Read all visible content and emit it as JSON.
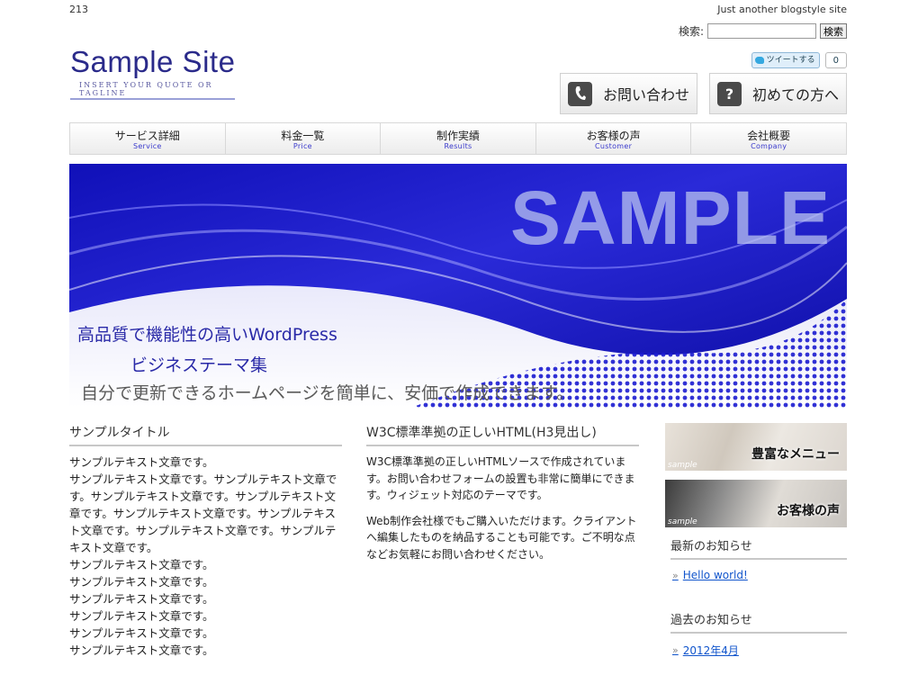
{
  "topbar": {
    "left": "213",
    "right": "Just another blogstyle site"
  },
  "search": {
    "label": "検索:",
    "button": "検索",
    "value": ""
  },
  "logo": {
    "name": "Sample Site",
    "tagline": "INSERT YOUR QUOTE OR TAGLINE"
  },
  "tweet": {
    "label": "ツイートする",
    "count": "0"
  },
  "cta": {
    "contact": "お問い合わせ",
    "first": "初めての方へ",
    "contact_icon": "phone-icon",
    "first_icon": "question-icon"
  },
  "nav": [
    {
      "jp": "サービス詳細",
      "en": "Service"
    },
    {
      "jp": "料金一覧",
      "en": "Price"
    },
    {
      "jp": "制作実績",
      "en": "Results"
    },
    {
      "jp": "お客様の声",
      "en": "Customer"
    },
    {
      "jp": "会社概要",
      "en": "Company"
    }
  ],
  "hero": {
    "big": "SAMPLE",
    "line1": "高品質で機能性の高いWordPress",
    "line2": "ビジネステーマ集",
    "line3": "自分で更新できるホームページを簡単に、安価で作成できます。"
  },
  "col1": {
    "title": "サンプルタイトル",
    "lines": [
      "サンプルテキスト文章です。",
      "サンプルテキスト文章です。サンプルテキスト文章です。サンプルテキスト文章です。サンプルテキスト文章です。サンプルテキスト文章です。サンプルテキスト文章です。サンプルテキスト文章です。サンプルテキスト文章です。",
      "サンプルテキスト文章です。",
      "サンプルテキスト文章です。",
      "サンプルテキスト文章です。",
      "サンプルテキスト文章です。",
      "サンプルテキスト文章です。",
      "サンプルテキスト文章です。"
    ]
  },
  "col2": {
    "title": "W3C標準準拠の正しいHTML(H3見出し)",
    "p1": "W3C標準準拠の正しいHTMLソースで作成されています。お問い合わせフォームの設置も非常に簡単にできます。ウィジェット対応のテーマです。",
    "p2": "Web制作会社様でもご購入いただけます。クライアントへ編集したものを納品することも可能です。ご不明な点などお気軽にお問い合わせください。"
  },
  "sidebar": {
    "banner1": {
      "label": "豊富なメニュー",
      "tag": "sample"
    },
    "banner2": {
      "label": "お客様の声",
      "tag": "sample"
    },
    "news_title": "最新のお知らせ",
    "news_link": "Hello world!",
    "archive_title": "過去のお知らせ",
    "archive_link": "2012年4月"
  },
  "colors": {
    "accent": "#2a2aa8",
    "link": "#1155cc",
    "hero_blue": "#1a1ad0"
  }
}
